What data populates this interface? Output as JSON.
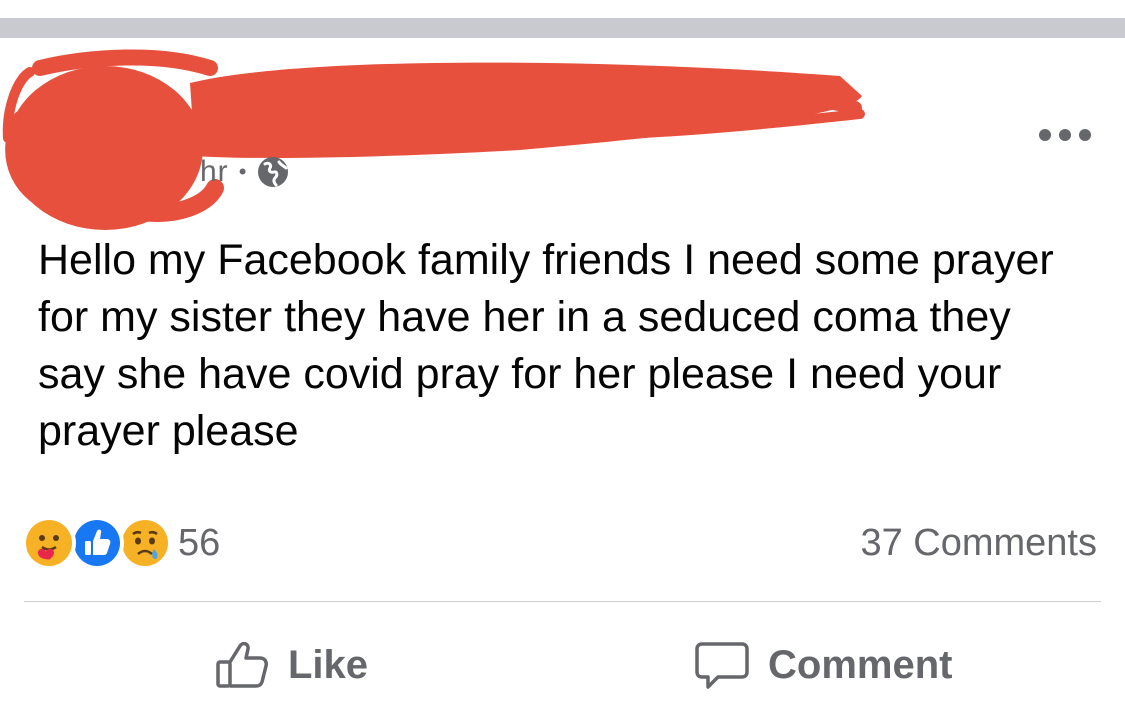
{
  "header": {
    "timestamp_partial": "hr",
    "separator": "•",
    "privacy_icon": "globe-icon",
    "more_icon": "more-options-icon",
    "redaction_color": "#e8503e"
  },
  "post": {
    "text": "Hello my Facebook family friends I need some prayer for my sister they have her in a seduced coma they say she have covid pray for her please I need your prayer please"
  },
  "reactions": {
    "icons": [
      "care-reaction-icon",
      "like-reaction-icon",
      "sad-reaction-icon"
    ],
    "count": "56"
  },
  "comments": {
    "count_label": "37 Comments"
  },
  "actions": {
    "like_label": "Like",
    "comment_label": "Comment"
  },
  "colors": {
    "text": "#050505",
    "secondary_text": "#65676b",
    "like_blue": "#1877f2",
    "divider": "#ced0d4"
  }
}
